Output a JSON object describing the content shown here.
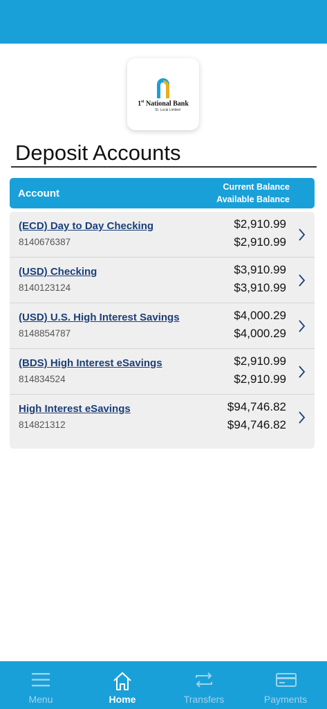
{
  "header": {
    "accent_color": "#1aa0d8"
  },
  "logo": {
    "line1_prefix": "1",
    "line1_sup": "st",
    "line1_rest": " National Bank",
    "line2": "St. Lucia Limited",
    "colors": {
      "arch_blue": "#1aa0d8",
      "arch_gold": "#e8b020"
    }
  },
  "section": {
    "title": "Deposit Accounts"
  },
  "table_header": {
    "account": "Account",
    "current_balance": "Current Balance",
    "available_balance": "Available Balance"
  },
  "accounts": [
    {
      "name": "(ECD) Day to Day Checking",
      "number": "8140676387",
      "current": "$2,910.99",
      "available": "$2,910.99"
    },
    {
      "name": "(USD) Checking",
      "number": "8140123124",
      "current": "$3,910.99",
      "available": "$3,910.99"
    },
    {
      "name": "(USD) U.S. High Interest Savings",
      "number": "8148854787",
      "current": "$4,000.29",
      "available": "$4,000.29"
    },
    {
      "name": "(BDS) High Interest eSavings",
      "number": "814834524",
      "current": "$2,910.99",
      "available": "$2,910.99"
    },
    {
      "name": "High Interest eSavings",
      "number": "814821312",
      "current": "$94,746.82",
      "available": "$94,746.82"
    }
  ],
  "tabs": [
    {
      "label": "Menu",
      "icon": "menu-icon",
      "active": false
    },
    {
      "label": "Home",
      "icon": "home-icon",
      "active": true
    },
    {
      "label": "Transfers",
      "icon": "transfers-icon",
      "active": false
    },
    {
      "label": "Payments",
      "icon": "payments-icon",
      "active": false
    }
  ]
}
